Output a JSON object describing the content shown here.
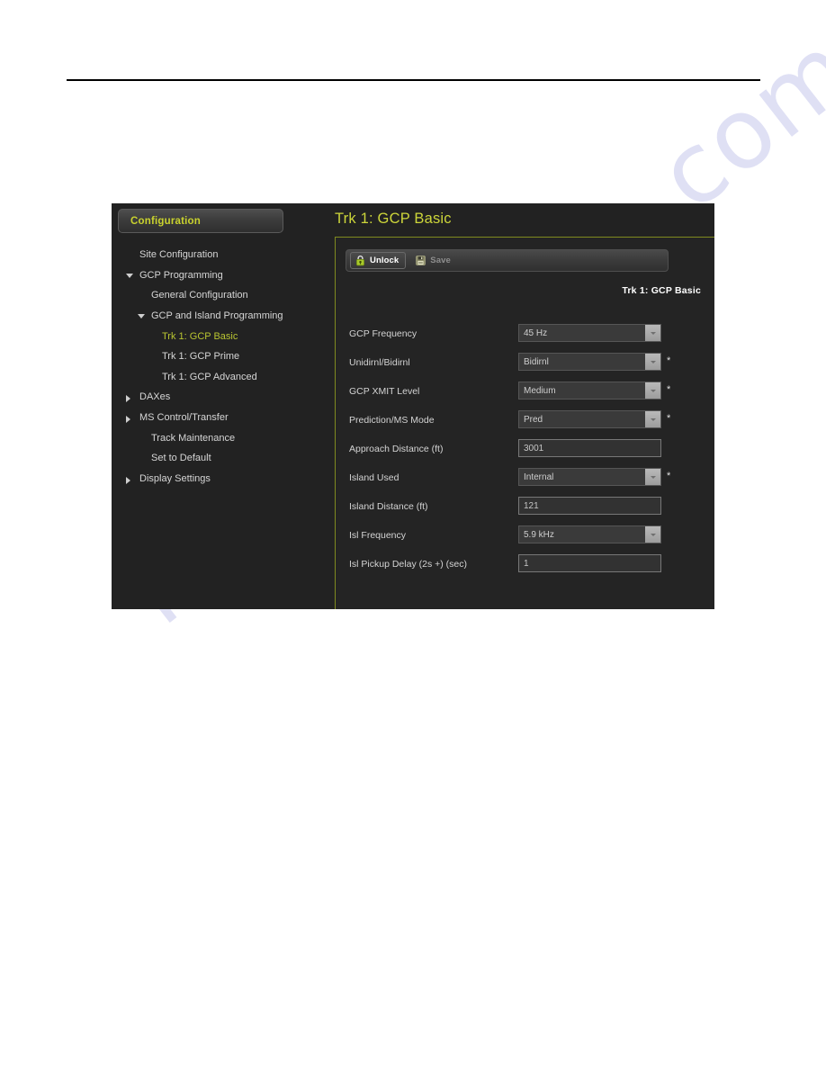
{
  "watermark": {
    "text": "manualshive.com"
  },
  "app": {
    "sidebar": {
      "header_label": "Configuration",
      "items": [
        {
          "label": "Site Configuration",
          "level": 1,
          "marker": "none",
          "selected": false
        },
        {
          "label": "GCP Programming",
          "level": 1,
          "marker": "down",
          "selected": false
        },
        {
          "label": "General Configuration",
          "level": 2,
          "marker": "none",
          "selected": false
        },
        {
          "label": "GCP and Island Programming",
          "level": 2,
          "marker": "down",
          "selected": false
        },
        {
          "label": "Trk 1: GCP Basic",
          "level": 3,
          "marker": "none",
          "selected": true
        },
        {
          "label": "Trk 1: GCP Prime",
          "level": 3,
          "marker": "none",
          "selected": false
        },
        {
          "label": "Trk 1: GCP Advanced",
          "level": 3,
          "marker": "none",
          "selected": false
        },
        {
          "label": "DAXes",
          "level": 1,
          "marker": "right",
          "selected": false
        },
        {
          "label": "MS Control/Transfer",
          "level": 1,
          "marker": "right",
          "selected": false
        },
        {
          "label": "Track Maintenance",
          "level": 2,
          "marker": "none",
          "selected": false
        },
        {
          "label": "Set to Default",
          "level": 2,
          "marker": "none",
          "selected": false
        },
        {
          "label": "Display Settings",
          "level": 1,
          "marker": "right",
          "selected": false
        }
      ]
    },
    "main": {
      "title": "Trk 1: GCP Basic",
      "panel_subtitle": "Trk 1: GCP Basic",
      "toolbar": {
        "unlock_label": "Unlock",
        "unlock_icon": "lock-icon",
        "save_label": "Save",
        "save_icon": "floppy-disk-icon"
      },
      "fields": [
        {
          "label": "GCP Frequency",
          "value": "45 Hz",
          "type": "select",
          "required": false
        },
        {
          "label": "Unidirnl/Bidirnl",
          "value": "Bidirnl",
          "type": "select",
          "required": true
        },
        {
          "label": "GCP XMIT Level",
          "value": "Medium",
          "type": "select",
          "required": true
        },
        {
          "label": "Prediction/MS Mode",
          "value": "Pred",
          "type": "select",
          "required": true
        },
        {
          "label": "Approach Distance (ft)",
          "value": "3001",
          "type": "text",
          "required": false
        },
        {
          "label": "Island Used",
          "value": "Internal",
          "type": "select",
          "required": true
        },
        {
          "label": "Island Distance (ft)",
          "value": "121",
          "type": "text",
          "required": false
        },
        {
          "label": "Isl Frequency",
          "value": "5.9 kHz",
          "type": "select",
          "required": false
        },
        {
          "label": "Isl Pickup Delay (2s +) (sec)",
          "value": "1",
          "type": "text",
          "required": false
        }
      ],
      "required_marker": "*"
    }
  },
  "colors": {
    "accent_green": "#cdd63a",
    "panel_border": "#7f8a1f",
    "window_bg": "#222222",
    "watermark": "#4448be"
  }
}
